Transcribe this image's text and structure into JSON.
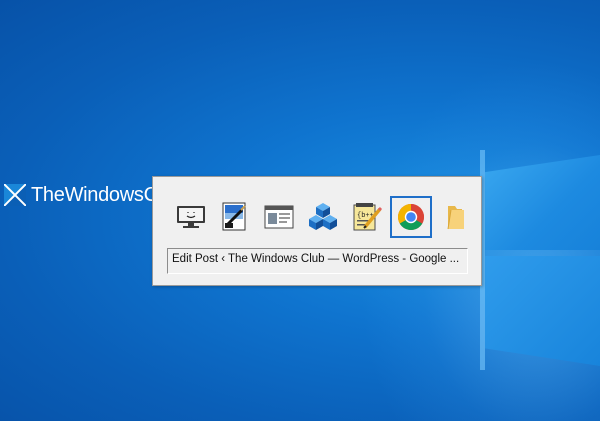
{
  "desktop": {
    "brand": {
      "text": "TheWindowsClub"
    }
  },
  "switcher": {
    "items": [
      {
        "name": "this-pc",
        "icon": "monitor-icon",
        "selected": false
      },
      {
        "name": "paint",
        "icon": "paint-icon",
        "selected": false
      },
      {
        "name": "notepad-window",
        "icon": "window-icon",
        "selected": false
      },
      {
        "name": "registry",
        "icon": "cubes-icon",
        "selected": false
      },
      {
        "name": "editor",
        "icon": "document-pencil-icon",
        "selected": false
      },
      {
        "name": "chrome",
        "icon": "chrome-icon",
        "selected": true
      },
      {
        "name": "folder",
        "icon": "folder-icon",
        "selected": false
      }
    ],
    "selected_title": "Edit Post ‹ The Windows Club — WordPress - Google ..."
  },
  "colors": {
    "desktop_blue": "#0f74cf",
    "selection_border": "#1f6fc9",
    "panel_bg": "#f0f0f0"
  }
}
